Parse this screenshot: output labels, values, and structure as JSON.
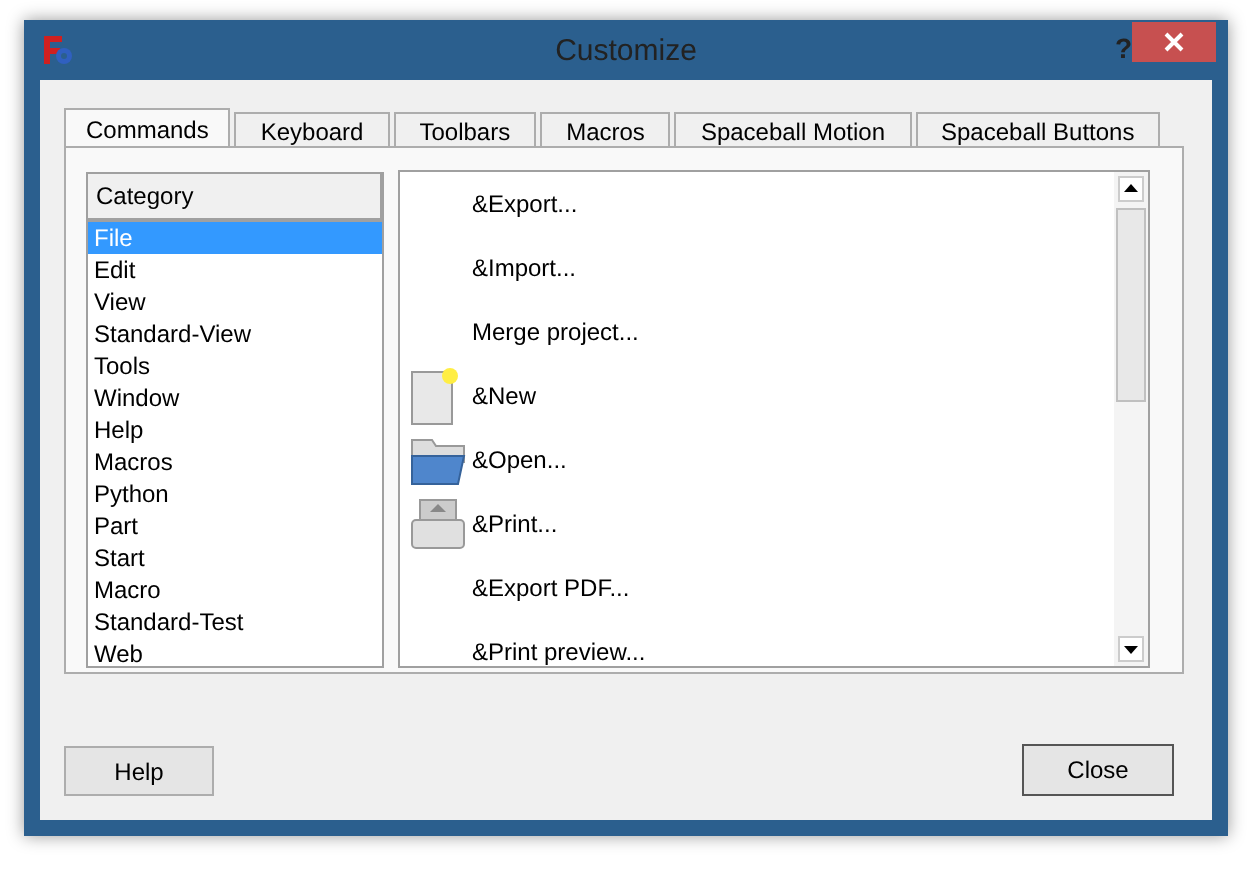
{
  "window": {
    "title": "Customize",
    "help_glyph": "?"
  },
  "tabs": [
    {
      "label": "Commands",
      "selected": true
    },
    {
      "label": "Keyboard",
      "selected": false
    },
    {
      "label": "Toolbars",
      "selected": false
    },
    {
      "label": "Macros",
      "selected": false
    },
    {
      "label": "Spaceball Motion",
      "selected": false
    },
    {
      "label": "Spaceball Buttons",
      "selected": false
    }
  ],
  "category_list": {
    "header": "Category",
    "items": [
      {
        "label": "File",
        "selected": true
      },
      {
        "label": "Edit",
        "selected": false
      },
      {
        "label": "View",
        "selected": false
      },
      {
        "label": "Standard-View",
        "selected": false
      },
      {
        "label": "Tools",
        "selected": false
      },
      {
        "label": "Window",
        "selected": false
      },
      {
        "label": "Help",
        "selected": false
      },
      {
        "label": "Macros",
        "selected": false
      },
      {
        "label": "Python",
        "selected": false
      },
      {
        "label": "Part",
        "selected": false
      },
      {
        "label": "Start",
        "selected": false
      },
      {
        "label": "Macro",
        "selected": false
      },
      {
        "label": "Standard-Test",
        "selected": false
      },
      {
        "label": "Web",
        "selected": false
      }
    ]
  },
  "commands": [
    {
      "label": "&Export..."
    },
    {
      "label": "&Import..."
    },
    {
      "label": "Merge project..."
    },
    {
      "label": "&New",
      "kind": "new"
    },
    {
      "label": "&Open...",
      "kind": "open"
    },
    {
      "label": "&Print...",
      "kind": "print"
    },
    {
      "label": "&Export PDF..."
    },
    {
      "label": "&Print preview..."
    }
  ],
  "buttons": [
    {
      "label": "Help"
    },
    {
      "label": "Close"
    }
  ]
}
